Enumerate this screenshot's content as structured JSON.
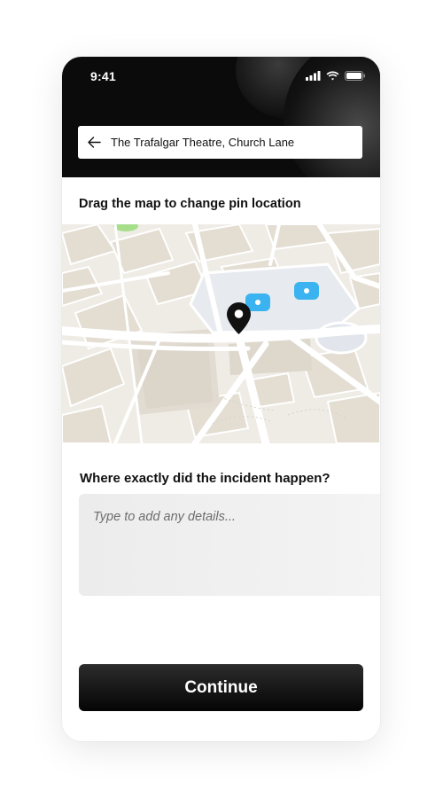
{
  "status_bar": {
    "time": "9:41",
    "icons": [
      "cellular-signal-icon",
      "wifi-icon",
      "battery-icon"
    ]
  },
  "search": {
    "value": "The Trafalgar Theatre, Church Lane",
    "back_icon": "arrow-left-icon"
  },
  "map_section": {
    "instruction": "Drag the map to change pin location",
    "pin_icon": "location-pin-icon"
  },
  "incident": {
    "question": "Where exactly did the incident happen?",
    "placeholder": "Type to add any details..."
  },
  "actions": {
    "continue_label": "Continue"
  },
  "colors": {
    "header": "#0b0b0b",
    "button": "#0b0b0b",
    "map_background": "#efece6",
    "map_accent": "#3bb3f0"
  }
}
